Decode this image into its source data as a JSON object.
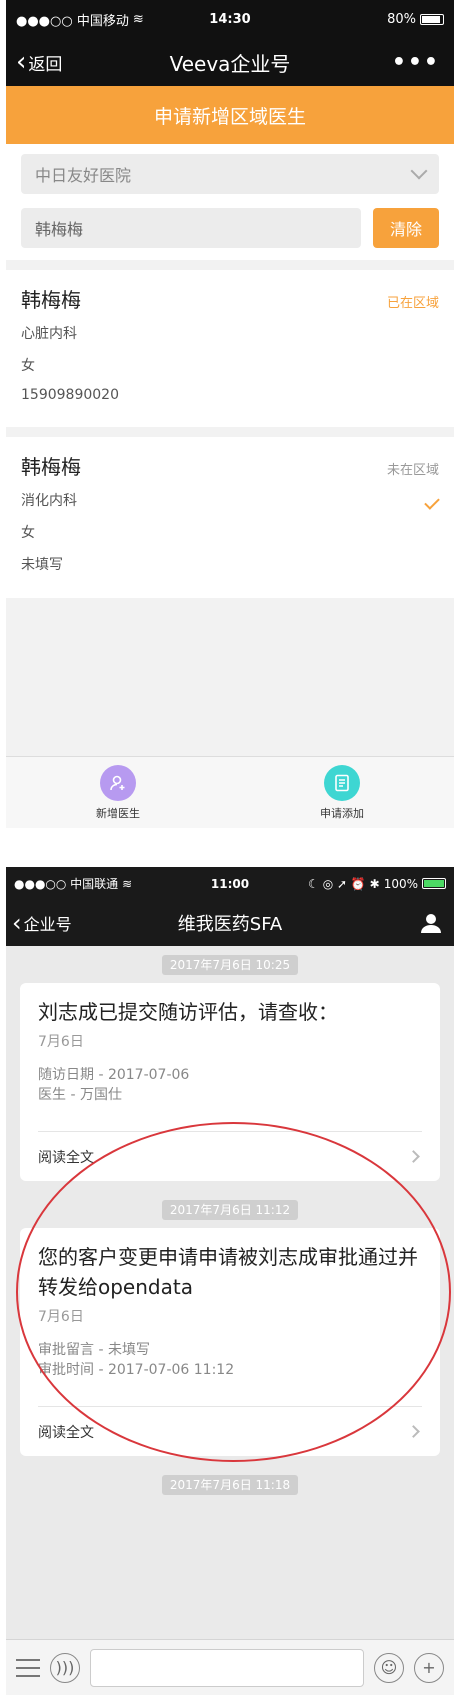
{
  "screen1": {
    "status": {
      "carrier": "●●●○○ 中国移动",
      "time": "14:30",
      "battery": "80%",
      "battery_fraction": 0.8
    },
    "nav": {
      "back": "返回",
      "title": "Veeva企业号",
      "more": "•••"
    },
    "header": "申请新增区域医生",
    "hospital_select": "中日友好医院",
    "search": {
      "value": "韩梅梅",
      "clear": "清除"
    },
    "doctors": [
      {
        "name": "韩梅梅",
        "dept": "心脏内科",
        "gender": "女",
        "phone": "15909890020",
        "status": "已在区域"
      },
      {
        "name": "韩梅梅",
        "dept": "消化内科",
        "gender": "女",
        "phone": "未填写",
        "status": "未在区域"
      }
    ],
    "tabs": [
      {
        "label": "新增医生"
      },
      {
        "label": "申请添加"
      }
    ]
  },
  "screen2": {
    "status": {
      "carrier": "●●●○○ 中国联通",
      "time": "11:00",
      "battery": "100%",
      "battery_fraction": 1.0
    },
    "nav": {
      "back": "企业号",
      "title": "维我医药SFA"
    },
    "timestamps": [
      "2017年7月6日 10:25",
      "2017年7月6日 11:12",
      "2017年7月6日 11:18"
    ],
    "cards": [
      {
        "title": "刘志成已提交随访评估，请查收：",
        "date": "7月6日",
        "meta1": "随访日期 - 2017-07-06",
        "meta2": "医生 - 万国仕",
        "read_more": "阅读全文"
      },
      {
        "title": "您的客户变更申请申请被刘志成审批通过并转发给opendata",
        "date": "7月6日",
        "meta1": "审批留言 - 未填写",
        "meta2": "审批时间 - 2017-07-06 11:12",
        "read_more": "阅读全文"
      }
    ]
  },
  "colors": {
    "accent": "#f7a23c",
    "annotation": "#d9373c"
  }
}
